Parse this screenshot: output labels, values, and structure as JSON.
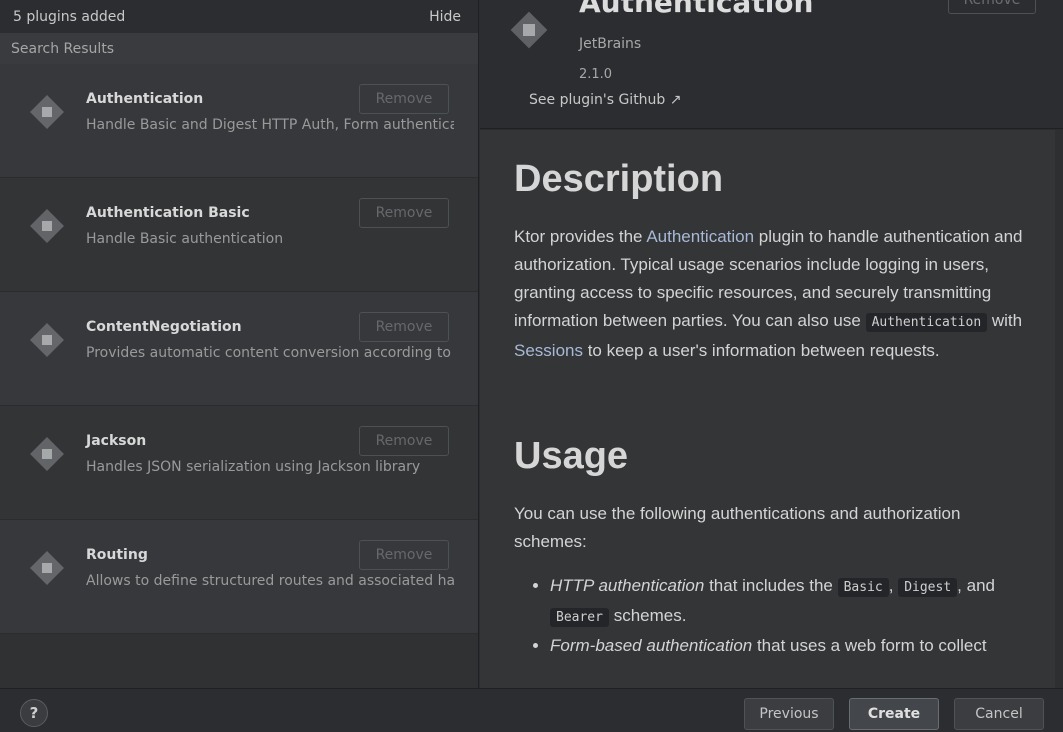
{
  "left_panel": {
    "header_text": "5 plugins added",
    "hide_label": "Hide",
    "section_label": "Search Results",
    "remove_label": "Remove",
    "plugins": [
      {
        "name": "Authentication",
        "description": "Handle Basic and Digest HTTP Auth, Form authenticatio"
      },
      {
        "name": "Authentication Basic",
        "description": "Handle Basic authentication"
      },
      {
        "name": "ContentNegotiation",
        "description": "Provides automatic content conversion according to Co"
      },
      {
        "name": "Jackson",
        "description": "Handles JSON serialization using Jackson library"
      },
      {
        "name": "Routing",
        "description": "Allows to define structured routes and associated handl"
      }
    ]
  },
  "detail": {
    "title": "Authentication",
    "vendor": "JetBrains",
    "version": "2.1.0",
    "github_link": "See plugin's Github ↗",
    "remove_label": "Remove",
    "description_heading": "Description",
    "desc_p1_a": "Ktor provides the ",
    "desc_p1_link1": "Authentication",
    "desc_p1_b": " plugin to handle authentication and authorization. Typical usage scenarios include logging in users, granting access to specific resources, and securely transmitting information between parties. You can also use ",
    "desc_p1_code": "Authentication",
    "desc_p1_c": " with ",
    "desc_p1_link2": "Sessions",
    "desc_p1_d": " to keep a user's information between requests.",
    "usage_heading": "Usage",
    "usage_p": "You can use the following authentications and authorization schemes:",
    "li1_em": "HTTP authentication",
    "li1_a": " that includes the ",
    "li1_code1": "Basic",
    "li1_sep1": ", ",
    "li1_code2": "Digest",
    "li1_sep2": ", and ",
    "li1_code3": "Bearer",
    "li1_b": " schemes.",
    "li2_em": "Form-based authentication",
    "li2_a": " that uses a web form to collect"
  },
  "bottom": {
    "help": "?",
    "previous": "Previous",
    "create": "Create",
    "cancel": "Cancel"
  }
}
